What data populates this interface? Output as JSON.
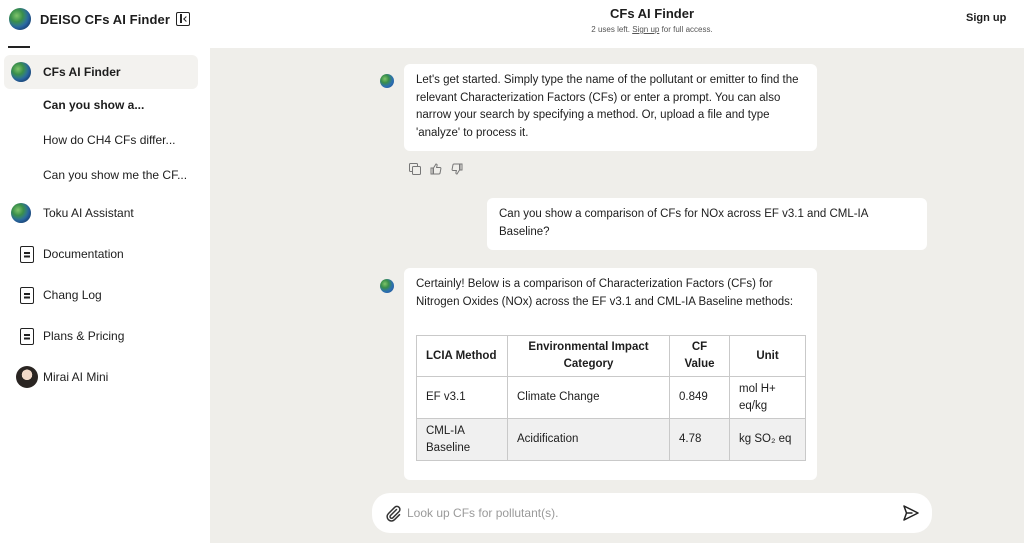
{
  "app": {
    "brand_title": "DEISO CFs AI Finder"
  },
  "sidebar": {
    "items": [
      {
        "label": "CFs AI Finder",
        "icon": "globe-icon"
      },
      {
        "label": "Toku AI Assistant",
        "icon": "globe-icon"
      },
      {
        "label": "Documentation",
        "icon": "document-icon"
      },
      {
        "label": "Chang Log",
        "icon": "document-icon"
      },
      {
        "label": "Plans & Pricing",
        "icon": "document-icon"
      },
      {
        "label": "Mirai AI Mini",
        "icon": "avatar-icon"
      }
    ],
    "history": [
      "Can you show a...",
      "How do CH4 CFs differ...",
      "Can you show me the CF..."
    ]
  },
  "header": {
    "title": "CFs AI Finder",
    "uses_left": "2 uses left.",
    "signup_link": "Sign up",
    "full_access": "for full access.",
    "signup_button": "Sign up"
  },
  "chat": {
    "bot_intro": "Let's get started. Simply type the name of the pollutant or emitter to find the relevant Characterization Factors (CFs) or enter a prompt. You can also narrow your search by specifying a method. Or, upload a file and type 'analyze' to process it.",
    "user_message": "Can you show a comparison of CFs for NOx across EF v3.1 and CML-IA Baseline?",
    "bot_answer": "Certainly! Below is a comparison of Characterization Factors (CFs) for Nitrogen Oxides (NOx) across the EF v3.1 and CML-IA Baseline methods:",
    "table": {
      "headers": [
        "LCIA Method",
        "Environmental Impact Category",
        "CF Value",
        "Unit"
      ],
      "rows": [
        [
          "EF v3.1",
          "Climate Change",
          "0.849",
          "mol H+ eq/kg"
        ],
        [
          "CML-IA Baseline",
          "Acidification",
          "4.78",
          "kg SO₂ eq"
        ]
      ]
    }
  },
  "input": {
    "placeholder": "Look up CFs for pollutant(s)."
  },
  "colors": {
    "main_bg": "#efeeea",
    "bubble_bg": "#ffffff",
    "active_item_bg": "#f3f2ef"
  }
}
